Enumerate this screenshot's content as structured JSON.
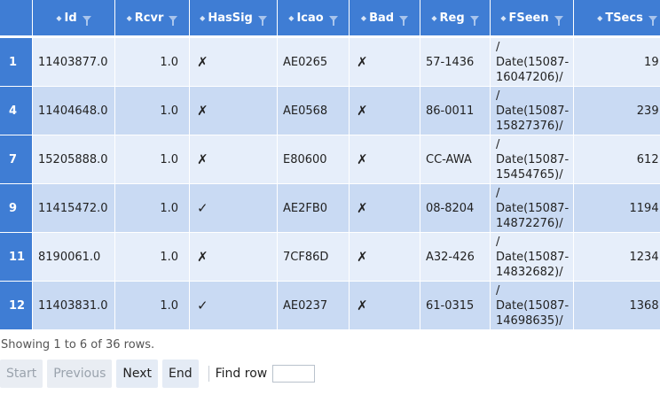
{
  "columns": [
    {
      "label": "",
      "name": "col-rownum"
    },
    {
      "label": "Id",
      "name": "col-id"
    },
    {
      "label": "Rcvr",
      "name": "col-rcvr"
    },
    {
      "label": "HasSig",
      "name": "col-hassig"
    },
    {
      "label": "Icao",
      "name": "col-icao"
    },
    {
      "label": "Bad",
      "name": "col-bad"
    },
    {
      "label": "Reg",
      "name": "col-reg"
    },
    {
      "label": "FSeen",
      "name": "col-fseen"
    },
    {
      "label": "TSecs",
      "name": "col-tsecs"
    }
  ],
  "icons": {
    "sort": "sort-arrows-icon",
    "filter": "filter-funnel-icon"
  },
  "rows": [
    {
      "rownum": "1",
      "id": "11403877.0",
      "rcvr": "1.0",
      "hassig": "✗",
      "icao": "AE0265",
      "bad": "✗",
      "reg": "57-1436",
      "fseen_l1": "/",
      "fseen_l2": "Date(15087-",
      "fseen_l3": "16047206)/",
      "tsecs": "19.0"
    },
    {
      "rownum": "4",
      "id": "11404648.0",
      "rcvr": "1.0",
      "hassig": "✗",
      "icao": "AE0568",
      "bad": "✗",
      "reg": "86-0011",
      "fseen_l1": "/",
      "fseen_l2": "Date(15087-",
      "fseen_l3": "15827376)/",
      "tsecs": "239.0"
    },
    {
      "rownum": "7",
      "id": "15205888.0",
      "rcvr": "1.0",
      "hassig": "✗",
      "icao": "E80600",
      "bad": "✗",
      "reg": "CC-AWA",
      "fseen_l1": "/",
      "fseen_l2": "Date(15087-",
      "fseen_l3": "15454765)/",
      "tsecs": "612.0"
    },
    {
      "rownum": "9",
      "id": "11415472.0",
      "rcvr": "1.0",
      "hassig": "✓",
      "icao": "AE2FB0",
      "bad": "✗",
      "reg": "08-8204",
      "fseen_l1": "/",
      "fseen_l2": "Date(15087-",
      "fseen_l3": "14872276)/",
      "tsecs": "1194.0"
    },
    {
      "rownum": "11",
      "id": "8190061.0",
      "rcvr": "1.0",
      "hassig": "✗",
      "icao": "7CF86D",
      "bad": "✗",
      "reg": "A32-426",
      "fseen_l1": "/",
      "fseen_l2": "Date(15087-",
      "fseen_l3": "14832682)/",
      "tsecs": "1234.0"
    },
    {
      "rownum": "12",
      "id": "11403831.0",
      "rcvr": "1.0",
      "hassig": "✓",
      "icao": "AE0237",
      "bad": "✗",
      "reg": "61-0315",
      "fseen_l1": "/",
      "fseen_l2": "Date(15087-",
      "fseen_l3": "14698635)/",
      "tsecs": "1368.0"
    }
  ],
  "status_text": "Showing 1 to 6 of 36 rows.",
  "pager": {
    "start_label": "Start",
    "previous_label": "Previous",
    "next_label": "Next",
    "end_label": "End",
    "find_label": "Find row",
    "find_value": ""
  },
  "colors": {
    "header": "#3f7dd4",
    "row_light": "#e6eefa",
    "row_dark": "#c9daf3"
  }
}
